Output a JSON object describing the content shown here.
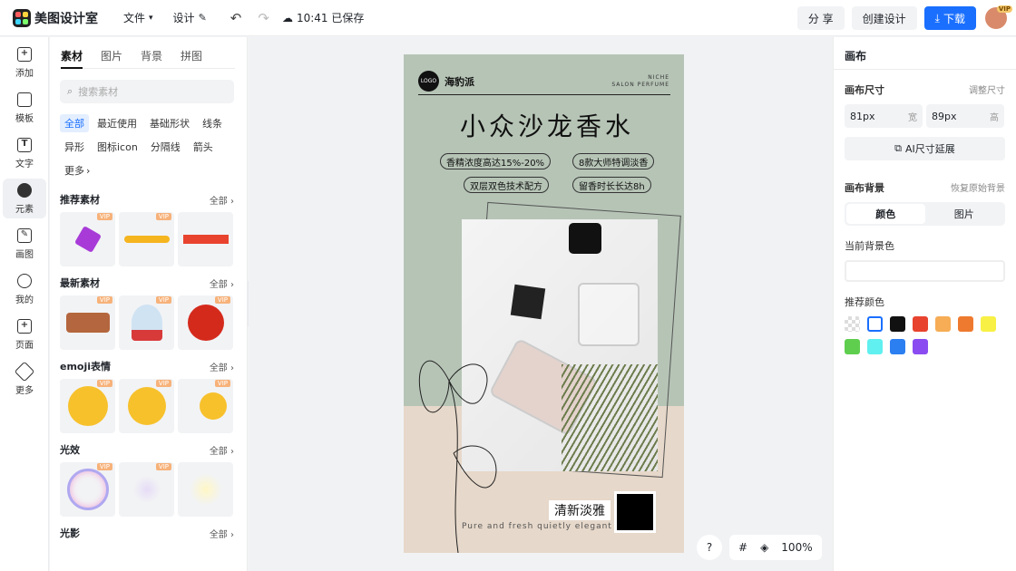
{
  "topbar": {
    "app_name": "美图设计室",
    "file_label": "文件",
    "design_label": "设计",
    "save_status": "10:41 已保存",
    "share_label": "分 享",
    "create_label": "创建设计",
    "download_label": "下载",
    "vip_badge": "VIP"
  },
  "leftnav": {
    "items": [
      {
        "label": "添加",
        "icon": "plus-icon"
      },
      {
        "label": "模板",
        "icon": "template-icon"
      },
      {
        "label": "文字",
        "icon": "text-icon"
      },
      {
        "label": "元素",
        "icon": "shapes-icon"
      },
      {
        "label": "画图",
        "icon": "pen-icon"
      },
      {
        "label": "我的",
        "icon": "user-icon"
      },
      {
        "label": "页面",
        "icon": "page-icon"
      },
      {
        "label": "更多",
        "icon": "cube-icon"
      }
    ],
    "active": "元素"
  },
  "panel": {
    "tabs": [
      "素材",
      "图片",
      "背景",
      "拼图"
    ],
    "active_tab": "素材",
    "search_placeholder": "搜索素材",
    "chips": [
      "全部",
      "最近使用",
      "基础形状",
      "线条",
      "异形",
      "图标icon",
      "分隔线",
      "箭头",
      "更多"
    ],
    "sections": [
      {
        "title": "推荐素材",
        "all": "全部"
      },
      {
        "title": "最新素材",
        "all": "全部"
      },
      {
        "title": "emoji表情",
        "all": "全部"
      },
      {
        "title": "光效",
        "all": "全部"
      },
      {
        "title": "光影",
        "all": "全部"
      }
    ],
    "vip": "VIP"
  },
  "poster": {
    "logo": "LOGO",
    "brand": "海豹派",
    "niche_line1": "NICHE",
    "niche_line2": "SALON PERFUME",
    "title": "小众沙龙香水",
    "pills": [
      "香精浓度高达15%-20%",
      "8款大师特调淡香",
      "双层双色技术配方",
      "留香时长长达8h"
    ],
    "slogan": "清新淡雅",
    "english": "Pure and fresh quietly elegant"
  },
  "zoom": {
    "help": "?",
    "level": "100%"
  },
  "right": {
    "title": "画布",
    "size_label": "画布尺寸",
    "size_adjust": "调整尺寸",
    "width_value": "81px",
    "width_unit": "宽",
    "height_value": "89px",
    "height_unit": "高",
    "ai_extend": "AI尺寸延展",
    "bg_label": "画布背景",
    "bg_reset": "恢复原始背景",
    "seg_color": "颜色",
    "seg_image": "图片",
    "current_bg": "当前背景色",
    "recommend": "推荐颜色",
    "swatches": [
      "transparent",
      "#ffffff",
      "#111111",
      "#e8432e",
      "#f6ad55",
      "#ee7a2f",
      "#f8f045",
      "#5fce4f",
      "#5ff0ef",
      "#2c7ff0",
      "#8a4cf0"
    ]
  }
}
